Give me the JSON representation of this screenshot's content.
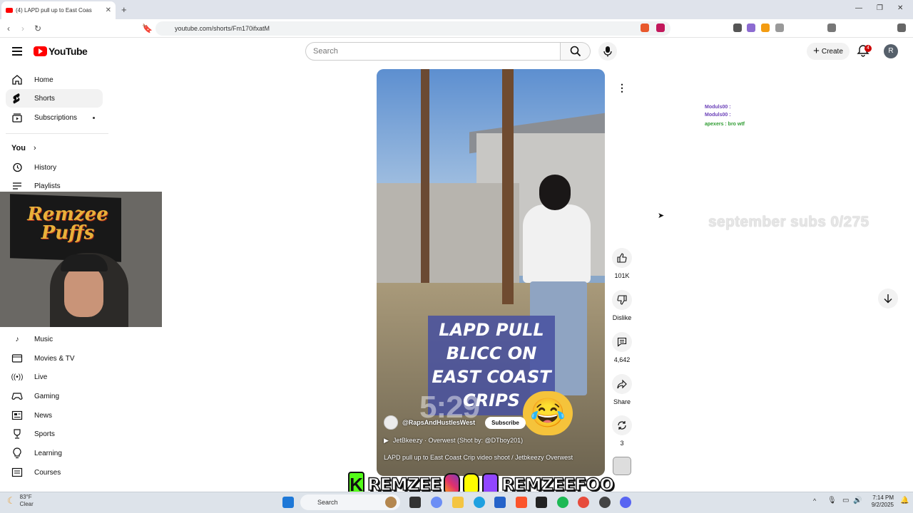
{
  "browser": {
    "tab_title": "(4) LAPD pull up to East Coast Crip video shoot / Jetbkeezy Overwest",
    "tab_title_short": "(4) LAPD pull up to East Coas",
    "url": "youtube.com/shorts/Fm170ifxatM"
  },
  "header": {
    "logo_text": "YouTube",
    "search_placeholder": "Search",
    "create_label": "Create",
    "notification_count": "4",
    "avatar_letter": "R"
  },
  "sidebar": {
    "items": [
      {
        "label": "Home",
        "icon": "home-icon"
      },
      {
        "label": "Shorts",
        "icon": "shorts-icon"
      },
      {
        "label": "Subscriptions",
        "icon": "subscriptions-icon"
      }
    ],
    "you_label": "You",
    "you_items": [
      {
        "label": "History",
        "icon": "history-icon"
      },
      {
        "label": "Playlists",
        "icon": "playlists-icon"
      }
    ],
    "explore_items": [
      {
        "label": "Music",
        "icon": "music-icon"
      },
      {
        "label": "Movies & TV",
        "icon": "movies-icon"
      },
      {
        "label": "Live",
        "icon": "live-icon"
      },
      {
        "label": "Gaming",
        "icon": "gaming-icon"
      },
      {
        "label": "News",
        "icon": "news-icon"
      },
      {
        "label": "Sports",
        "icon": "sports-icon"
      },
      {
        "label": "Learning",
        "icon": "learning-icon"
      },
      {
        "label": "Courses",
        "icon": "courses-icon"
      }
    ]
  },
  "webcam": {
    "flag_text": "Remzee Puffs"
  },
  "video": {
    "caption": "LAPD PULL BLICC ON EAST COAST CRIPS",
    "timestamp_overlay": "5:29",
    "channel": "@RapsAndHustlesWest",
    "subscribe_label": "Subscribe",
    "music": "JetBkeezy · Overwest (Shot by: @DTboy201)",
    "title": "LAPD pull up to East Coast Crip video shoot / Jetbkeezy Overwest"
  },
  "actions": {
    "likes": "101K",
    "dislike_label": "Dislike",
    "comments": "4,642",
    "share_label": "Share",
    "remix_count": "3"
  },
  "overlay": {
    "subs_goal": "september subs 0/275",
    "chat": [
      "Moduls00 : ",
      "Moduls00 : ",
      "apexers : bro wtf"
    ],
    "banner_name1": "REMZEE",
    "banner_name2": "REMZEEFOO"
  },
  "taskbar": {
    "temp": "83°F",
    "weather": "Clear",
    "search": "Search",
    "time": "7:14 PM",
    "date": "9/2/2025"
  },
  "colors": {
    "brand": "#ff0000",
    "kick": "#53fc18",
    "twitch": "#9146ff"
  }
}
